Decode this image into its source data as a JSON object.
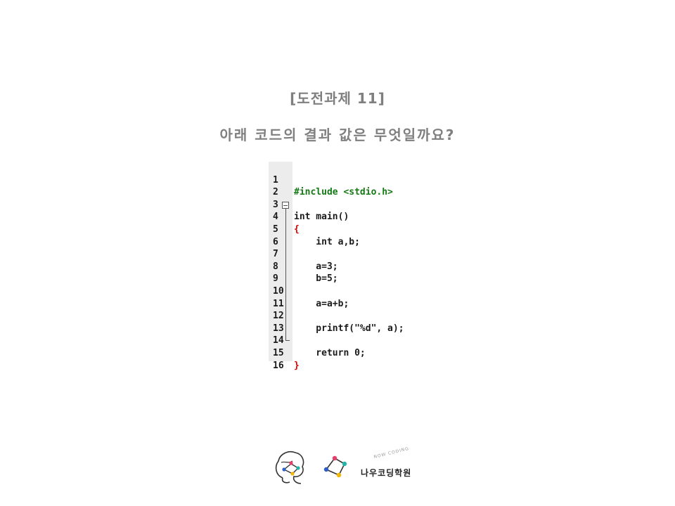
{
  "title": "[도전과제 11]",
  "question": "아래 코드의 결과 값은 무엇일까요?",
  "code_lines": [
    {
      "n": "1",
      "code": "#include <stdio.h>"
    },
    {
      "n": "2",
      "code": ""
    },
    {
      "n": "3",
      "code": "int main()"
    },
    {
      "n": "4",
      "code": "{"
    },
    {
      "n": "5",
      "code": "    int a,b;"
    },
    {
      "n": "6",
      "code": ""
    },
    {
      "n": "7",
      "code": "    a=3;"
    },
    {
      "n": "8",
      "code": "    b=5;"
    },
    {
      "n": "9",
      "code": ""
    },
    {
      "n": "10",
      "code": "    a=a+b;"
    },
    {
      "n": "11",
      "code": ""
    },
    {
      "n": "12",
      "code": "    printf(\"%d\", a);"
    },
    {
      "n": "13",
      "code": ""
    },
    {
      "n": "14",
      "code": "    return 0;"
    },
    {
      "n": "15",
      "code": "}"
    },
    {
      "n": "16",
      "code": ""
    }
  ],
  "brand": {
    "name": "나우코딩학원",
    "tagline": "NOW CODING"
  },
  "colors": {
    "node_pink": "#e83e6c",
    "node_blue": "#2f5fc4",
    "node_teal": "#22b5a8",
    "node_yellow": "#f2b705"
  }
}
